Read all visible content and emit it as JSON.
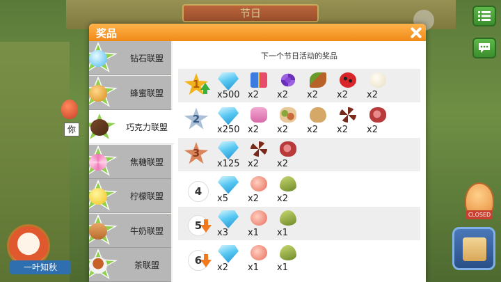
{
  "background": {
    "title": "节日",
    "tooltip_char": "你",
    "player_name": "一叶知秋",
    "closed_label": "CLOSED"
  },
  "panel": {
    "title": "奖品",
    "subtitle": "下一个节日活动的奖品"
  },
  "tabs": [
    {
      "label": "钻石联盟",
      "icon": "diamond-icon",
      "color": "#8fd14f",
      "active": false
    },
    {
      "label": "蜂蜜联盟",
      "icon": "honey-pot-icon",
      "color": "#8fd14f",
      "active": false
    },
    {
      "label": "巧克力联盟",
      "icon": "chocolate-icon",
      "color": "#8fd14f",
      "active": true
    },
    {
      "label": "焦糖联盟",
      "icon": "lollipop-icon",
      "color": "#8fd14f",
      "active": false
    },
    {
      "label": "柠檬联盟",
      "icon": "lemon-icon",
      "color": "#8fd14f",
      "active": false
    },
    {
      "label": "牛奶联盟",
      "icon": "milk-jug-icon",
      "color": "#8fd14f",
      "active": false
    },
    {
      "label": "茶联盟",
      "icon": "tea-cup-icon",
      "color": "#8fd14f",
      "active": false
    }
  ],
  "ranks": [
    {
      "rank": "1",
      "badge": "gold",
      "arrow": "up",
      "items": [
        {
          "icon": "diamond-icon",
          "qty": "x500"
        },
        {
          "icon": "gift-box-icon",
          "qty": "x2"
        },
        {
          "icon": "violet-flower-icon",
          "qty": "x2"
        },
        {
          "icon": "cocoa-pod-icon",
          "qty": "x2"
        },
        {
          "icon": "ladybug-icon",
          "qty": "x2"
        },
        {
          "icon": "egg-icon",
          "qty": "x2"
        }
      ]
    },
    {
      "rank": "2",
      "badge": "silver",
      "arrow": "",
      "items": [
        {
          "icon": "diamond-icon",
          "qty": "x250"
        },
        {
          "icon": "pink-pouch-icon",
          "qty": "x2"
        },
        {
          "icon": "nut-mix-icon",
          "qty": "x2"
        },
        {
          "icon": "peanut-icon",
          "qty": "x2"
        },
        {
          "icon": "star-anise-icon",
          "qty": "x2"
        },
        {
          "icon": "meat-icon",
          "qty": "x2"
        }
      ]
    },
    {
      "rank": "3",
      "badge": "bronze",
      "arrow": "",
      "items": [
        {
          "icon": "diamond-icon",
          "qty": "x125"
        },
        {
          "icon": "star-anise-icon",
          "qty": "x2"
        },
        {
          "icon": "meat-icon",
          "qty": "x2"
        }
      ]
    },
    {
      "rank": "4",
      "badge": "plain",
      "arrow": "",
      "items": [
        {
          "icon": "diamond-icon",
          "qty": "x5"
        },
        {
          "icon": "peach-icon",
          "qty": "x2"
        },
        {
          "icon": "cardamom-icon",
          "qty": "x2"
        }
      ]
    },
    {
      "rank": "5",
      "badge": "plain",
      "arrow": "down",
      "items": [
        {
          "icon": "diamond-icon",
          "qty": "x3"
        },
        {
          "icon": "peach-icon",
          "qty": "x1"
        },
        {
          "icon": "cardamom-icon",
          "qty": "x1"
        }
      ]
    },
    {
      "rank": "6",
      "badge": "plain",
      "arrow": "down",
      "items": [
        {
          "icon": "diamond-icon",
          "qty": "x2"
        },
        {
          "icon": "peach-icon",
          "qty": "x1"
        },
        {
          "icon": "cardamom-icon",
          "qty": "x1"
        }
      ]
    }
  ],
  "colors": {
    "header": "#f08a18",
    "gold": "#f2b21c",
    "silver": "#a9bfd6",
    "bronze": "#d9845a",
    "tab_inactive": "#b7b7b7"
  }
}
